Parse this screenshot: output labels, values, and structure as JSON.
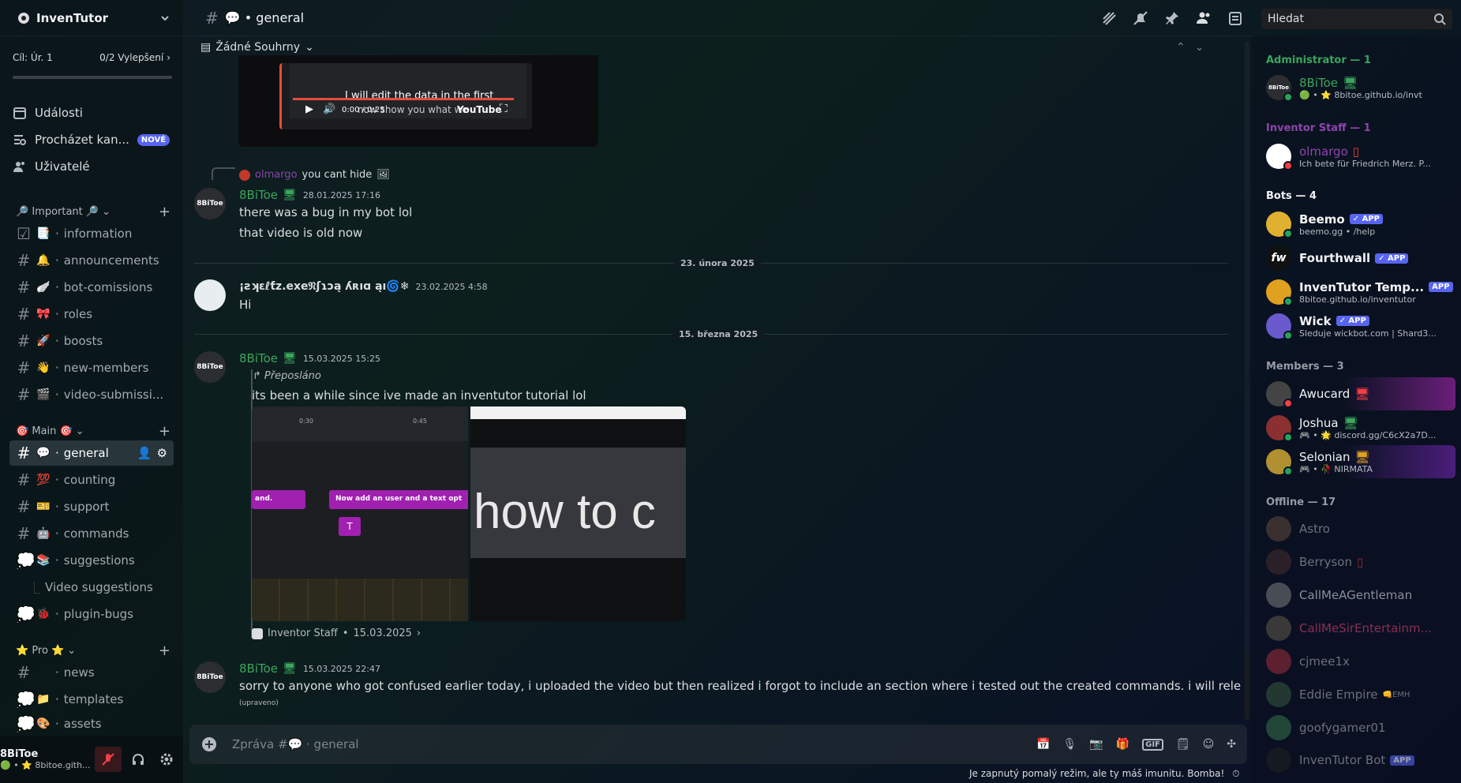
{
  "server": {
    "name": "InvenTutor"
  },
  "goal": {
    "left": "Cíl: Úr. 1",
    "right": "0/2 Vylepšení",
    "progress": 0.0
  },
  "nav": [
    {
      "label": "Události",
      "icon": "calendar-icon"
    },
    {
      "label": "Procházet kan...",
      "icon": "browse-channels-icon",
      "badge": "NOVÉ"
    },
    {
      "label": "Uživatelé",
      "icon": "members-icon"
    }
  ],
  "categories": [
    {
      "label": "🔎 Important 🔎",
      "channels": [
        {
          "emoji": "📑",
          "name": "information"
        },
        {
          "emoji": "🔔",
          "name": "announcements"
        },
        {
          "emoji": "🪽",
          "name": "bot-comissions"
        },
        {
          "emoji": "🎀",
          "name": "roles"
        },
        {
          "emoji": "🚀",
          "name": "boosts"
        },
        {
          "emoji": "👋",
          "name": "new-members"
        },
        {
          "emoji": "🎬",
          "name": "video-submissi..."
        }
      ]
    },
    {
      "label": "🎯 Main 🎯",
      "channels": [
        {
          "emoji": "💬",
          "name": "general",
          "selected": true
        },
        {
          "emoji": "💯",
          "name": "counting"
        },
        {
          "emoji": "🎫",
          "name": "support"
        },
        {
          "emoji": "🤖",
          "name": "commands"
        },
        {
          "emoji": "📚",
          "name": "suggestions"
        },
        {
          "emoji": "",
          "name": "Video suggestions",
          "thread": true
        },
        {
          "emoji": "🐞",
          "name": "plugin-bugs"
        }
      ]
    },
    {
      "label": "⭐ Pro ⭐",
      "channels": [
        {
          "emoji": "",
          "name": "news"
        },
        {
          "emoji": "📁",
          "name": "templates"
        },
        {
          "emoji": "🎨",
          "name": "assets"
        }
      ]
    }
  ],
  "user_panel": {
    "name": "8BiToe",
    "status": "🟢 • ⭐ 8bitoe.gith..."
  },
  "topbar": {
    "channel": "💬 • general",
    "search_placeholder": "Hledat",
    "summaries": "Žádné Souhrny"
  },
  "messages": {
    "reply": {
      "author": "olmargo",
      "text": "you cant hide"
    },
    "m1": {
      "author": "8BiToe",
      "time": "28.01.2025 17:16",
      "lines": [
        "there was a bug in my bot lol",
        "that video is old now"
      ]
    },
    "div1": "23. února 2025",
    "m2": {
      "author": "¡ƨʞɛℓƭz.exe𝔑ʃɿɔą ʎʀıɑ ąı🌀❄",
      "time": "23.02.2025 4:58",
      "text": "Hi"
    },
    "div2": "15. března 2025",
    "m3": {
      "author": "8BiToe",
      "time": "15.03.2025 15:25",
      "forwarded": "Přeposláno",
      "text": "its been a while since ive made an inventutor tutorial lol",
      "source": "Inventor Staff",
      "source_date": "15.03.2025",
      "img1_t1": "0:30",
      "img1_t2": "0:45",
      "img1_clip1": "and.",
      "img1_clip2": "Now add an user and a text opt",
      "img2_text": "how to c"
    },
    "m4": {
      "author": "8BiToe",
      "time": "15.03.2025 22:47",
      "text": "sorry to anyone who got confused earlier today, i uploaded the video but then realized i forgot to include an section where i tested out the created commands. i will release it soon",
      "edited": "(upraveno)"
    },
    "video": {
      "caption1": "I will edit the data in the first",
      "caption2": "now show you what we",
      "time": "0:00 / 0:25",
      "brand": "YouTube"
    }
  },
  "composer": {
    "placeholder": "Zpráva #💬 · general"
  },
  "slowmode": "Je zapnutý pomalý režim, ale ty máš imunitu. Bomba!",
  "members": {
    "groups": [
      {
        "title": "Administrator — 1"
      },
      {
        "title": "Inventor Staff — 1"
      },
      {
        "title": "Bots — 4"
      },
      {
        "title": "Members — 3"
      },
      {
        "title": "Offline — 17"
      }
    ],
    "admin": [
      {
        "name": "8BiToe",
        "sub": "🟢 • ⭐ 8bitoe.github.io/invt"
      }
    ],
    "staff": [
      {
        "name": "olmargo",
        "sub": "Ich bete für Friedrich Merz. P..."
      }
    ],
    "bots": [
      {
        "name": "Beemo",
        "sub": "beemo.gg • /help",
        "badge": "✓ APP"
      },
      {
        "name": "Fourthwall",
        "sub": "",
        "badge": "✓ APP"
      },
      {
        "name": "InvenTutor Temp...",
        "sub": "8bitoe.github.io/inventutor",
        "badge": "APP"
      },
      {
        "name": "Wick",
        "sub": "Sleduje wickbot.com | Shard3...",
        "badge": "✓ APP"
      }
    ],
    "members": [
      {
        "name": "Awucard",
        "sub": ""
      },
      {
        "name": "Joshua",
        "sub": "🎮 • 🌟 discord.gg/C6cX2a7D..."
      },
      {
        "name": "Selonian",
        "sub": "🎮 • 🥀 NIRMATA"
      }
    ],
    "offline": [
      {
        "name": "Astro"
      },
      {
        "name": "Berryson"
      },
      {
        "name": "CallMeAGentleman"
      },
      {
        "name": "CallMeSirEntertainm..."
      },
      {
        "name": "cjmee1x"
      },
      {
        "name": "Eddie Empire",
        "tag": "👊EMH"
      },
      {
        "name": "goofygamer01"
      },
      {
        "name": "InvenTutor Bot",
        "badge": "APP"
      }
    ]
  },
  "colors": {
    "accent": "#5865f2",
    "online": "#23a55a",
    "admin_green": "#3ba55c",
    "staff_purple": "#8e44ad",
    "dnd": "#f23f43"
  }
}
